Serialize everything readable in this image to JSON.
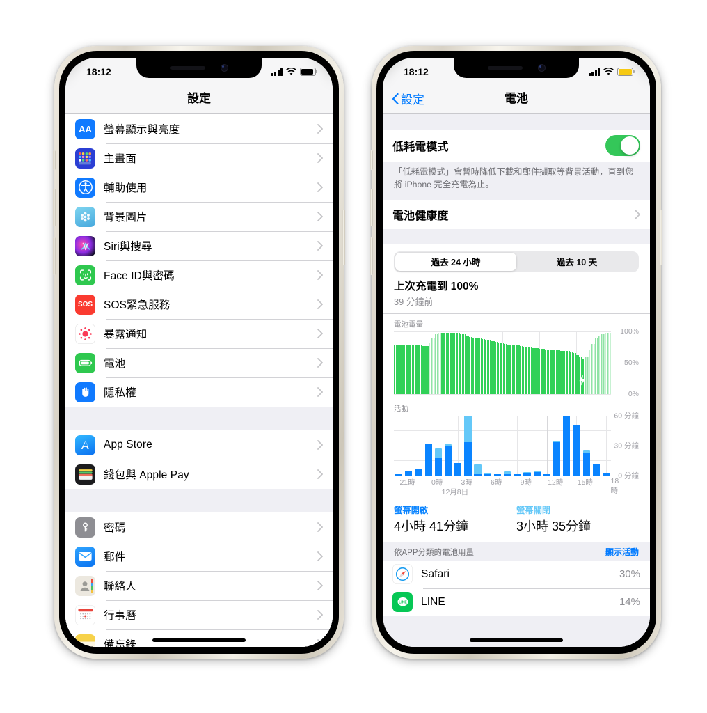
{
  "left_phone": {
    "status_bar": {
      "time": "18:12",
      "battery_style": "dark",
      "wifi": "wifi-icon",
      "cellular": "signal-bars-icon"
    },
    "nav": {
      "title": "設定"
    },
    "groups": [
      {
        "rows": [
          {
            "label": "螢幕顯示與亮度",
            "icon": "display-brightness-icon"
          },
          {
            "label": "主畫面",
            "icon": "home-screen-icon"
          },
          {
            "label": "輔助使用",
            "icon": "accessibility-icon"
          },
          {
            "label": "背景圖片",
            "icon": "wallpaper-icon"
          },
          {
            "label": "Siri與搜尋",
            "icon": "siri-icon"
          },
          {
            "label": "Face ID與密碼",
            "icon": "face-id-icon"
          },
          {
            "label": "SOS緊急服務",
            "icon": "sos-icon"
          },
          {
            "label": "暴露通知",
            "icon": "exposure-notification-icon"
          },
          {
            "label": "電池",
            "icon": "battery-icon"
          },
          {
            "label": "隱私權",
            "icon": "privacy-hand-icon"
          }
        ]
      },
      {
        "rows": [
          {
            "label": "App Store",
            "icon": "app-store-icon"
          },
          {
            "label": "錢包與 Apple Pay",
            "icon": "wallet-icon"
          }
        ]
      },
      {
        "rows": [
          {
            "label": "密碼",
            "icon": "passwords-key-icon"
          },
          {
            "label": "郵件",
            "icon": "mail-icon"
          },
          {
            "label": "聯絡人",
            "icon": "contacts-icon"
          },
          {
            "label": "行事曆",
            "icon": "calendar-icon"
          },
          {
            "label": "備忘錄",
            "icon": "notes-icon"
          }
        ]
      }
    ]
  },
  "right_phone": {
    "status_bar": {
      "time": "18:12",
      "battery_style": "yellow-low-power",
      "wifi": "wifi-icon",
      "cellular": "signal-bars-icon"
    },
    "nav": {
      "back_label": "設定",
      "title": "電池"
    },
    "low_power": {
      "label": "低耗電模式",
      "toggle_state": "on",
      "toggle_color": "#34c759"
    },
    "footnote": "「低耗電模式」會暫時降低下載和郵件擷取等背景活動，直到您將 iPhone 完全充電為止。",
    "battery_health": {
      "label": "電池健康度"
    },
    "segmented": {
      "options": [
        "過去 24 小時",
        "過去 10 天"
      ],
      "selected_index": 0
    },
    "last_charge": {
      "title": "上次充電到 100%",
      "subtitle": "39 分鐘前"
    },
    "charts": {
      "battery_level_label": "電池電量",
      "activity_label": "活動"
    },
    "usage": {
      "screen_on_key": "螢幕開啟",
      "screen_on_value": "4小時 41分鐘",
      "screen_off_key": "螢幕關閉",
      "screen_off_value": "3小時 35分鐘",
      "screen_on_color": "#0a84ff",
      "screen_off_color": "#64c8f8"
    },
    "by_app": {
      "title": "依APP分類的電池用量",
      "action": "顯示活動",
      "rows": [
        {
          "name": "Safari",
          "percent": "30%",
          "icon": "safari-icon"
        },
        {
          "name": "LINE",
          "percent": "14%",
          "icon": "line-icon"
        }
      ]
    }
  },
  "chart_data": [
    {
      "type": "bar",
      "title": "電池電量",
      "id": "battery-level-chart",
      "xlabel": "",
      "ylabel": "%",
      "ylim": [
        0,
        100
      ],
      "yticks": [
        0,
        50,
        100
      ],
      "ytick_labels": [
        "0%",
        "50%",
        "100%"
      ],
      "grid": true,
      "series_color_solid": "#31d158",
      "series_color_charging": "#8fe3a5",
      "note": "Hatched/light bars indicate charging periods; lightning bolt marker near hour 16-17 region.",
      "values": [
        78,
        78,
        78,
        78,
        78,
        78,
        77,
        77,
        77,
        76,
        76,
        82,
        90,
        95,
        97,
        97,
        97,
        97,
        97,
        97,
        97,
        96,
        96,
        93,
        91,
        90,
        89,
        88,
        87,
        86,
        85,
        84,
        83,
        82,
        81,
        80,
        79,
        78,
        78,
        77,
        76,
        75,
        74,
        74,
        73,
        73,
        72,
        72,
        71,
        71,
        71,
        70,
        70,
        69,
        69,
        68,
        67,
        65,
        62,
        58,
        55,
        58,
        70,
        80,
        88,
        93,
        96,
        97,
        97
      ],
      "charging_flags": [
        0,
        0,
        0,
        0,
        0,
        0,
        0,
        0,
        0,
        0,
        0,
        1,
        1,
        1,
        1,
        0,
        0,
        0,
        0,
        0,
        0,
        0,
        0,
        0,
        0,
        0,
        0,
        0,
        0,
        0,
        0,
        0,
        0,
        0,
        0,
        0,
        0,
        0,
        0,
        0,
        0,
        0,
        0,
        0,
        0,
        0,
        0,
        0,
        0,
        0,
        0,
        0,
        0,
        0,
        0,
        0,
        0,
        0,
        0,
        0,
        0,
        1,
        1,
        1,
        1,
        1,
        1,
        1,
        1
      ]
    },
    {
      "type": "bar",
      "title": "活動",
      "id": "activity-chart",
      "xlabel": "",
      "ylabel": "分鐘",
      "ylim": [
        0,
        60
      ],
      "yticks": [
        0,
        30,
        60
      ],
      "ytick_labels": [
        "0 分鐘",
        "30 分鐘",
        "60 分鐘"
      ],
      "xticks": [
        "21時",
        "0時",
        "3時",
        "6時",
        "9時",
        "12時",
        "15時",
        "18時"
      ],
      "x_date_label": "12月8日",
      "grid": true,
      "legend": [
        "螢幕開啟",
        "螢幕關閉"
      ],
      "series": [
        {
          "name": "螢幕開啟",
          "color": "#0a84ff",
          "values": [
            1.5,
            5,
            6.5,
            31,
            17,
            29,
            12,
            33,
            1,
            1.5,
            1,
            1,
            1,
            2,
            3,
            1,
            33,
            60,
            50,
            23,
            11,
            2
          ]
        },
        {
          "name": "螢幕關閉",
          "color": "#64c8f8",
          "values": [
            0,
            0,
            0,
            1,
            10,
            2.5,
            0,
            27,
            10,
            1,
            0.5,
            3,
            0.5,
            1.5,
            1.5,
            0.5,
            2,
            0,
            0,
            2,
            0,
            0
          ]
        }
      ],
      "x_positions_note": "22 hourly bars spanning 21時 to 18時"
    }
  ]
}
